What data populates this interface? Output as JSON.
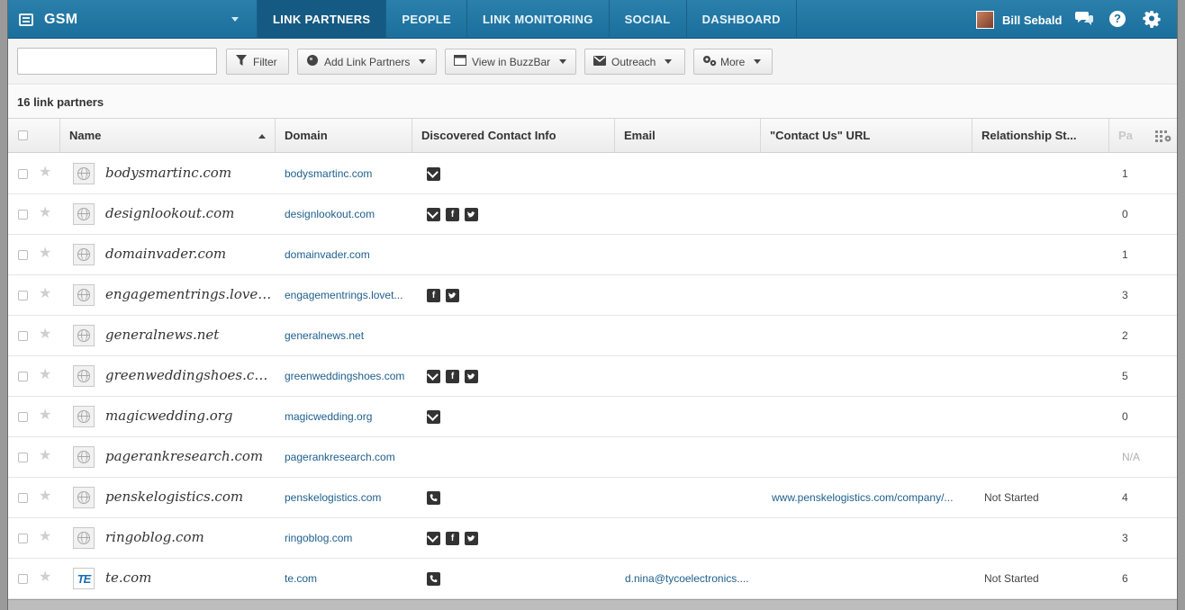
{
  "nav": {
    "app_title": "GSM",
    "tabs": [
      {
        "label": "LINK PARTNERS",
        "active": true
      },
      {
        "label": "PEOPLE",
        "active": false
      },
      {
        "label": "LINK MONITORING",
        "active": false
      },
      {
        "label": "SOCIAL",
        "active": false
      },
      {
        "label": "DASHBOARD",
        "active": false
      }
    ],
    "user_name": "Bill Sebald",
    "icons": [
      "grid-icon",
      "chat-icon",
      "help-icon",
      "gear-icon"
    ],
    "help_glyph": "?"
  },
  "toolbar": {
    "search_value": "",
    "filter_label": "Filter",
    "add_label": "Add Link Partners",
    "buzzbar_label": "View in BuzzBar",
    "outreach_label": "Outreach",
    "more_label": "More"
  },
  "count_label": "16 link partners",
  "table": {
    "columns": [
      "Name",
      "Domain",
      "Discovered Contact Info",
      "Email",
      "\"Contact Us\" URL",
      "Relationship St...",
      "Pa"
    ],
    "sort": {
      "column": "Name",
      "direction": "asc"
    },
    "rows": [
      {
        "name": "bodysmartinc.com",
        "domain": "bodysmartinc.com",
        "contact": [
          "email"
        ],
        "email": "",
        "url": "",
        "relationship": "",
        "pages": "1",
        "logo": "globe"
      },
      {
        "name": "designlookout.com",
        "domain": "designlookout.com",
        "contact": [
          "email",
          "facebook",
          "twitter"
        ],
        "email": "",
        "url": "",
        "relationship": "",
        "pages": "0",
        "logo": "globe"
      },
      {
        "name": "domainvader.com",
        "domain": "domainvader.com",
        "contact": [],
        "email": "",
        "url": "",
        "relationship": "",
        "pages": "1",
        "logo": "globe"
      },
      {
        "name": "engagementrings.loveto...",
        "domain": "engagementrings.lovet...",
        "contact": [
          "facebook",
          "twitter"
        ],
        "email": "",
        "url": "",
        "relationship": "",
        "pages": "3",
        "logo": "globe"
      },
      {
        "name": "generalnews.net",
        "domain": "generalnews.net",
        "contact": [],
        "email": "",
        "url": "",
        "relationship": "",
        "pages": "2",
        "logo": "globe"
      },
      {
        "name": "greenweddingshoes.com",
        "domain": "greenweddingshoes.com",
        "contact": [
          "email",
          "facebook",
          "twitter"
        ],
        "email": "",
        "url": "",
        "relationship": "",
        "pages": "5",
        "logo": "globe"
      },
      {
        "name": "magicwedding.org",
        "domain": "magicwedding.org",
        "contact": [
          "email"
        ],
        "email": "",
        "url": "",
        "relationship": "",
        "pages": "0",
        "logo": "globe"
      },
      {
        "name": "pagerankresearch.com",
        "domain": "pagerankresearch.com",
        "contact": [],
        "email": "",
        "url": "",
        "relationship": "",
        "pages": "N/A",
        "logo": "globe"
      },
      {
        "name": "penskelogistics.com",
        "domain": "penskelogistics.com",
        "contact": [
          "phone"
        ],
        "email": "",
        "url": "www.penskelogistics.com/company/...",
        "relationship": "Not Started",
        "pages": "4",
        "logo": "globe"
      },
      {
        "name": "ringoblog.com",
        "domain": "ringoblog.com",
        "contact": [
          "email",
          "facebook",
          "twitter"
        ],
        "email": "",
        "url": "",
        "relationship": "",
        "pages": "3",
        "logo": "globe"
      },
      {
        "name": "te.com",
        "domain": "te.com",
        "contact": [
          "phone"
        ],
        "email": "d.nina@tycoelectronics....",
        "url": "",
        "relationship": "Not Started",
        "pages": "6",
        "logo": "TE"
      }
    ]
  },
  "colors": {
    "nav_bg": "#1c6f9c",
    "nav_active": "#155a83",
    "link": "#1e5f8c"
  }
}
